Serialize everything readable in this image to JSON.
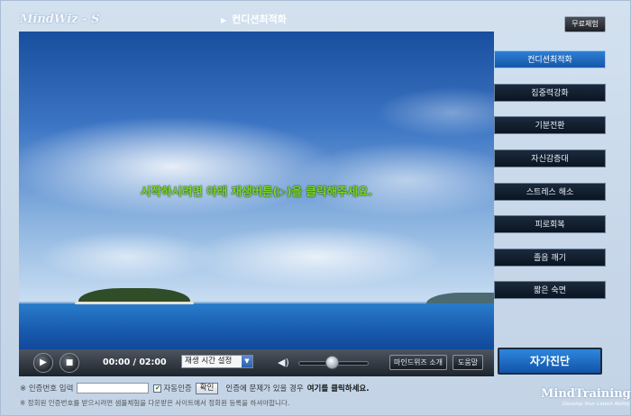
{
  "header": {
    "brand": "MindWiz - S",
    "title": "컨디션최적화",
    "free_trial": "무료체험"
  },
  "video": {
    "message": "시작하시려면 아래 재생버튼(▷)을 클릭해주세요."
  },
  "sidebar": {
    "items": [
      {
        "label": "컨디션최적화"
      },
      {
        "label": "집중력강화"
      },
      {
        "label": "기분전환"
      },
      {
        "label": "자신감증대"
      },
      {
        "label": "스트레스 해소"
      },
      {
        "label": "피로회복"
      },
      {
        "label": "졸음 깨기"
      },
      {
        "label": "짧은 숙면"
      }
    ],
    "self_check": "자가진단"
  },
  "controls": {
    "time": "00:00 / 02:00",
    "time_setting": "재생 시간 설정",
    "mindwiz_intro": "마인드위즈 소개",
    "help": "도움말"
  },
  "auth": {
    "label": "※ 인증번호 입력",
    "input_value": "",
    "auto_auth": "자동인증",
    "confirm": "확인",
    "notice": "인증에 문제가 있을 경우",
    "notice_link": "여기를 클릭하세요.",
    "info": "※ 정회원 인증번호를 받으시려면 샘플체험을 다운받은 사이트에서 정회원 등록을 하셔야합니다."
  },
  "footer": {
    "logo": "MindTraining",
    "logo_sub": "Develop Your Latent Ability"
  },
  "colors": {
    "active_menu": "#1f6fc6",
    "menu": "#0f1b2b",
    "message": "#7cd62c"
  }
}
